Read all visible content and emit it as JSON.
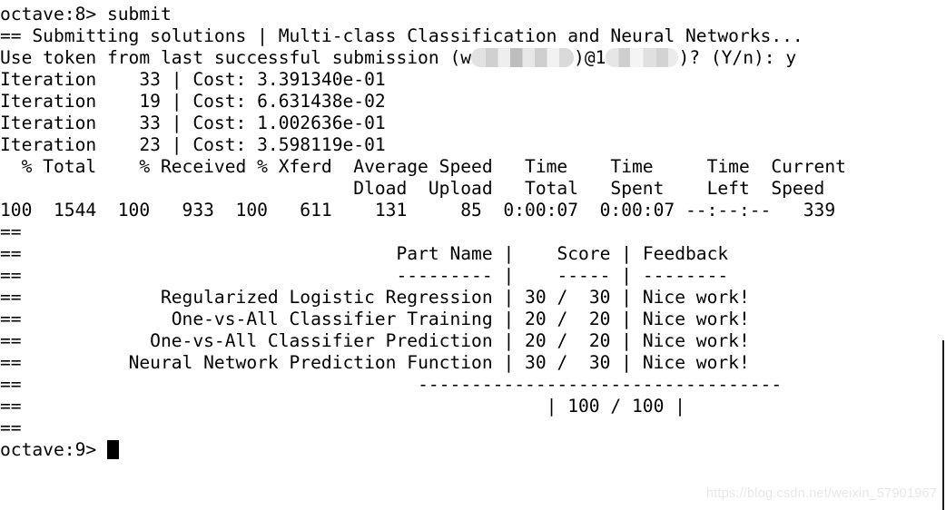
{
  "terminal": {
    "shell": "octave",
    "prompt_in": "octave:8> ",
    "command": "submit",
    "header_line": "== Submitting solutions | Multi-class Classification and Neural Networks...",
    "token_prompt_prefix": "Use token from last successful submission (w",
    "token_prompt_mid": ")@1",
    "token_prompt_suffix": ")? (Y/n): ",
    "token_answer": "y",
    "iterations": [
      {
        "label": "Iteration",
        "number": "33",
        "bar": "|",
        "cost_label": "Cost:",
        "cost": "3.391340e-01"
      },
      {
        "label": "Iteration",
        "number": "19",
        "bar": "|",
        "cost_label": "Cost:",
        "cost": "6.631438e-02"
      },
      {
        "label": "Iteration",
        "number": "33",
        "bar": "|",
        "cost_label": "Cost:",
        "cost": "1.002636e-01"
      },
      {
        "label": "Iteration",
        "number": "23",
        "bar": "|",
        "cost_label": "Cost:",
        "cost": "3.598119e-01"
      }
    ],
    "curl": {
      "header_row1": "  % Total    % Received % Xferd  Average Speed   Time    Time     Time  Current",
      "header_row2": "                                 Dload  Upload   Total   Spent    Left  Speed",
      "data_row": "100  1544  100   933  100   611    131     85  0:00:07  0:00:07 --:--:--   339"
    },
    "marker": "==",
    "results": {
      "col_part_name": "Part Name",
      "col_score": "Score",
      "col_feedback": "Feedback",
      "underline_part_name": "---------",
      "underline_score": "-----",
      "underline_feedback": "--------",
      "separator": "----------------------------------",
      "rows": [
        {
          "part": "Regularized Logistic Regression",
          "earned": "30",
          "slash": "/",
          "total": "30",
          "feedback": "Nice work!"
        },
        {
          "part": "One-vs-All Classifier Training",
          "earned": "20",
          "slash": "/",
          "total": "20",
          "feedback": "Nice work!"
        },
        {
          "part": "One-vs-All Classifier Prediction",
          "earned": "20",
          "slash": "/",
          "total": "20",
          "feedback": "Nice work!"
        },
        {
          "part": "Neural Network Prediction Function",
          "earned": "30",
          "slash": "/",
          "total": "30",
          "feedback": "Nice work!"
        }
      ],
      "total_row": "| 100 / 100 |",
      "total_earned": "100",
      "total_possible": "100"
    },
    "prompt_out": "octave:9> "
  },
  "watermark": {
    "text": "https://blog.csdn.net/weixin_57901967"
  },
  "colors": {
    "background": "#ffffff",
    "text": "#000000",
    "watermark": "#e8e8e8",
    "edge": "#1a1a1a"
  }
}
